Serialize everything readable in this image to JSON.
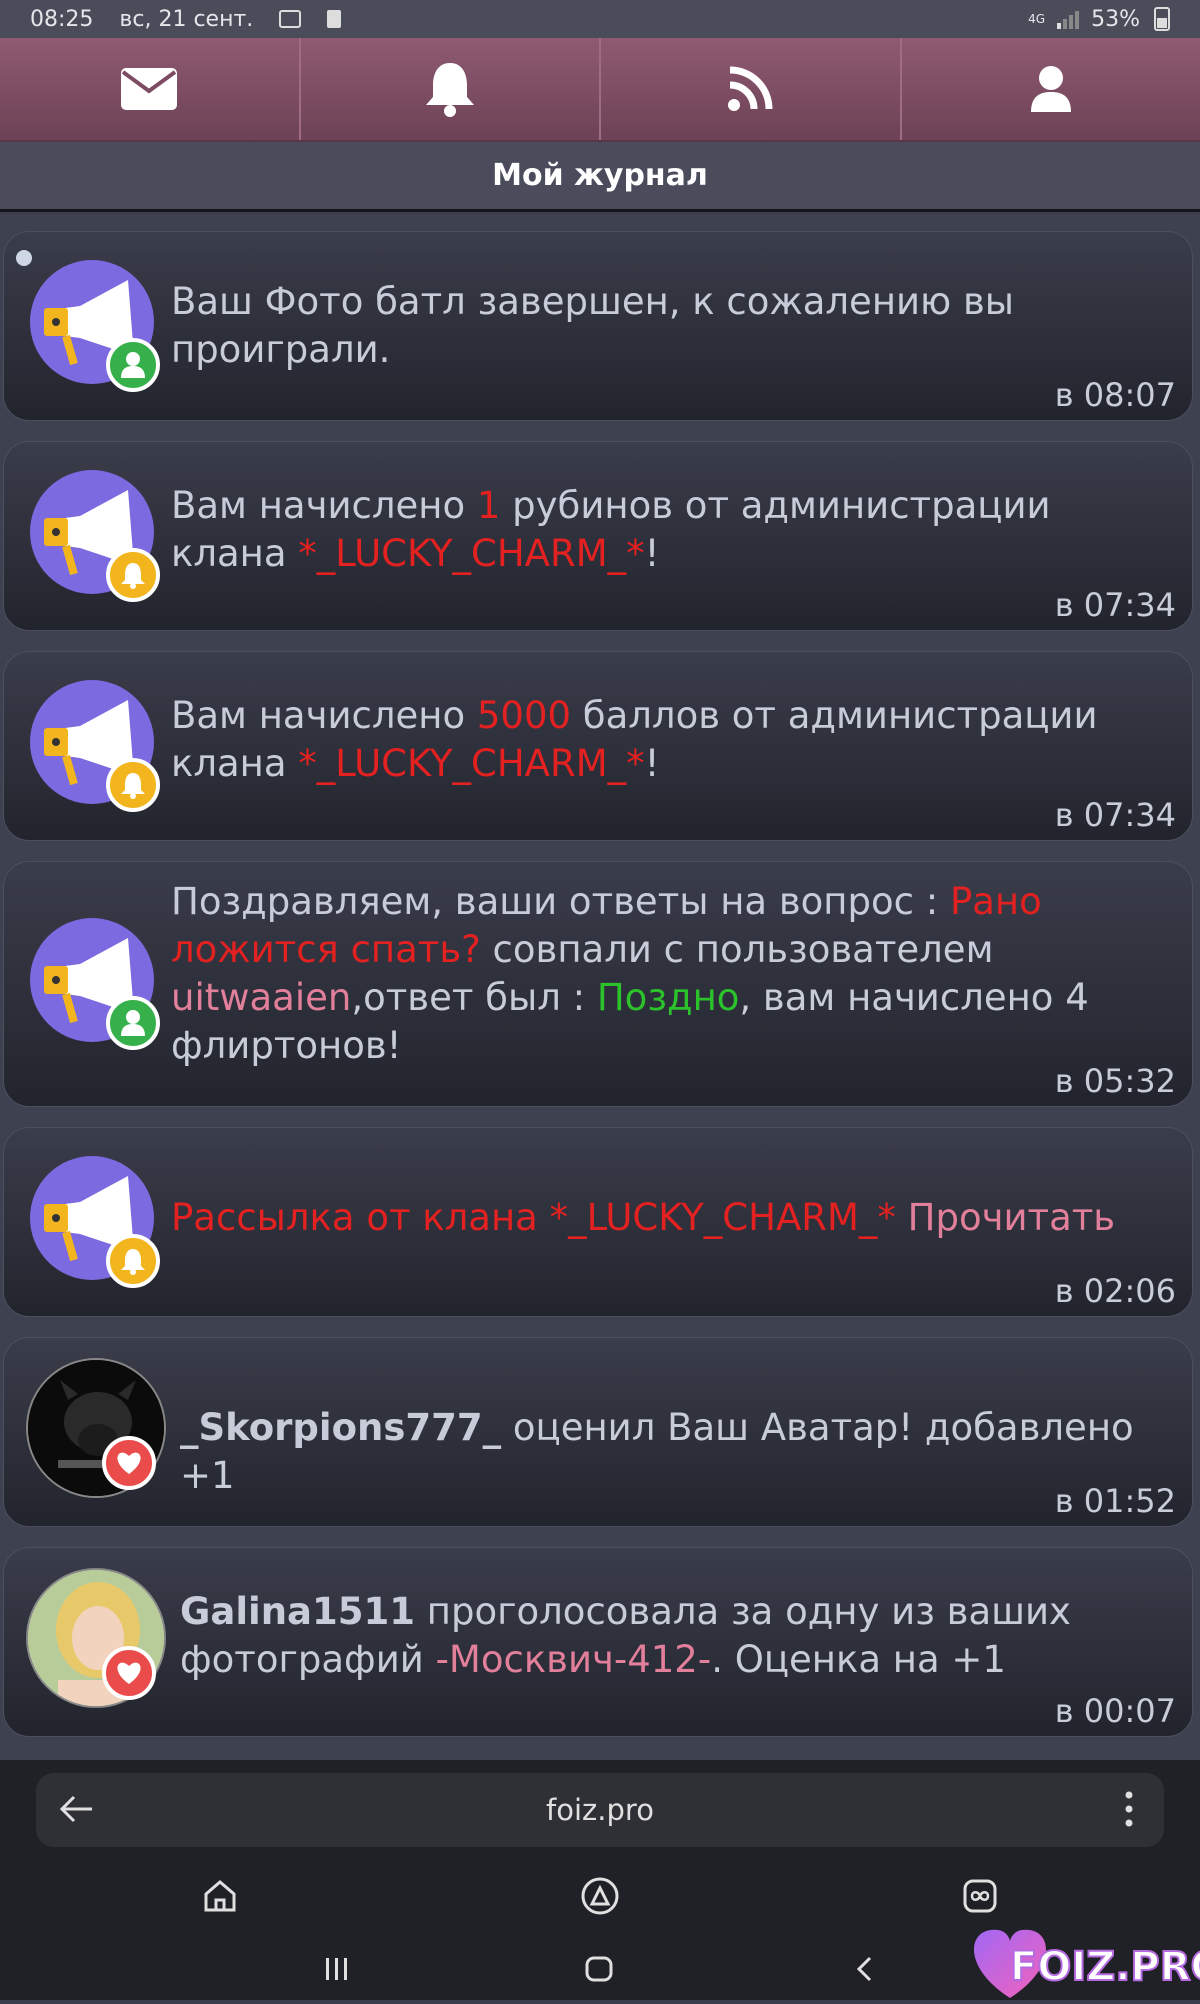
{
  "status_bar": {
    "time": "08:25",
    "date": "вс, 21 сент.",
    "network": "4G",
    "battery": "53%"
  },
  "nav": {
    "icons": [
      "envelope-icon",
      "bell-icon",
      "rss-icon",
      "user-icon"
    ]
  },
  "header": {
    "title": "Мой журнал"
  },
  "notifications": [
    {
      "text": "Ваш Фото батл завершен, к сожалению вы проиграли.",
      "time": "в 08:07",
      "badge": "user"
    },
    {
      "text_1": "Вам начислено ",
      "amount": "1",
      "text_2": " рубинов от администрации клана ",
      "clan": "*_LUCKY_CHARM_*",
      "text_3": "!",
      "time": "в 07:34",
      "badge": "bell"
    },
    {
      "text_1": "Вам начислено ",
      "amount": "5000",
      "text_2": " баллов от администрации клана ",
      "clan": "*_LUCKY_CHARM_*",
      "text_3": "!",
      "time": "в 07:34",
      "badge": "bell"
    },
    {
      "text_1": "Поздравляем, ваши ответы на вопрос : ",
      "question": "Рано ложится спать?",
      "text_2": " совпали с пользователем ",
      "user": "uitwaaien",
      "text_3": ",ответ был : ",
      "answer": "Поздно",
      "text_4": ", вам начислено 4 флиртонов!",
      "time": "в 05:32",
      "badge": "user"
    },
    {
      "text_1": "Рассылка от клана *_LUCKY_CHARM_*",
      "link": "Прочитать",
      "time": "в 02:06",
      "badge": "bell"
    },
    {
      "user": "_Skorpions777_",
      "text_1": " оценил Ваш Аватар! добавлено +1",
      "time": "в 01:52",
      "badge": "heart"
    },
    {
      "user": "Galina1511",
      "text_1": " проголосовала за одну из ваших фотографий ",
      "photo": "-Москвич-412-",
      "text_2": ". Оценка на +1",
      "time": "в 00:07",
      "badge": "heart"
    }
  ],
  "browser": {
    "url": "foiz.pro"
  },
  "watermark": "FOIZ.PRO"
}
